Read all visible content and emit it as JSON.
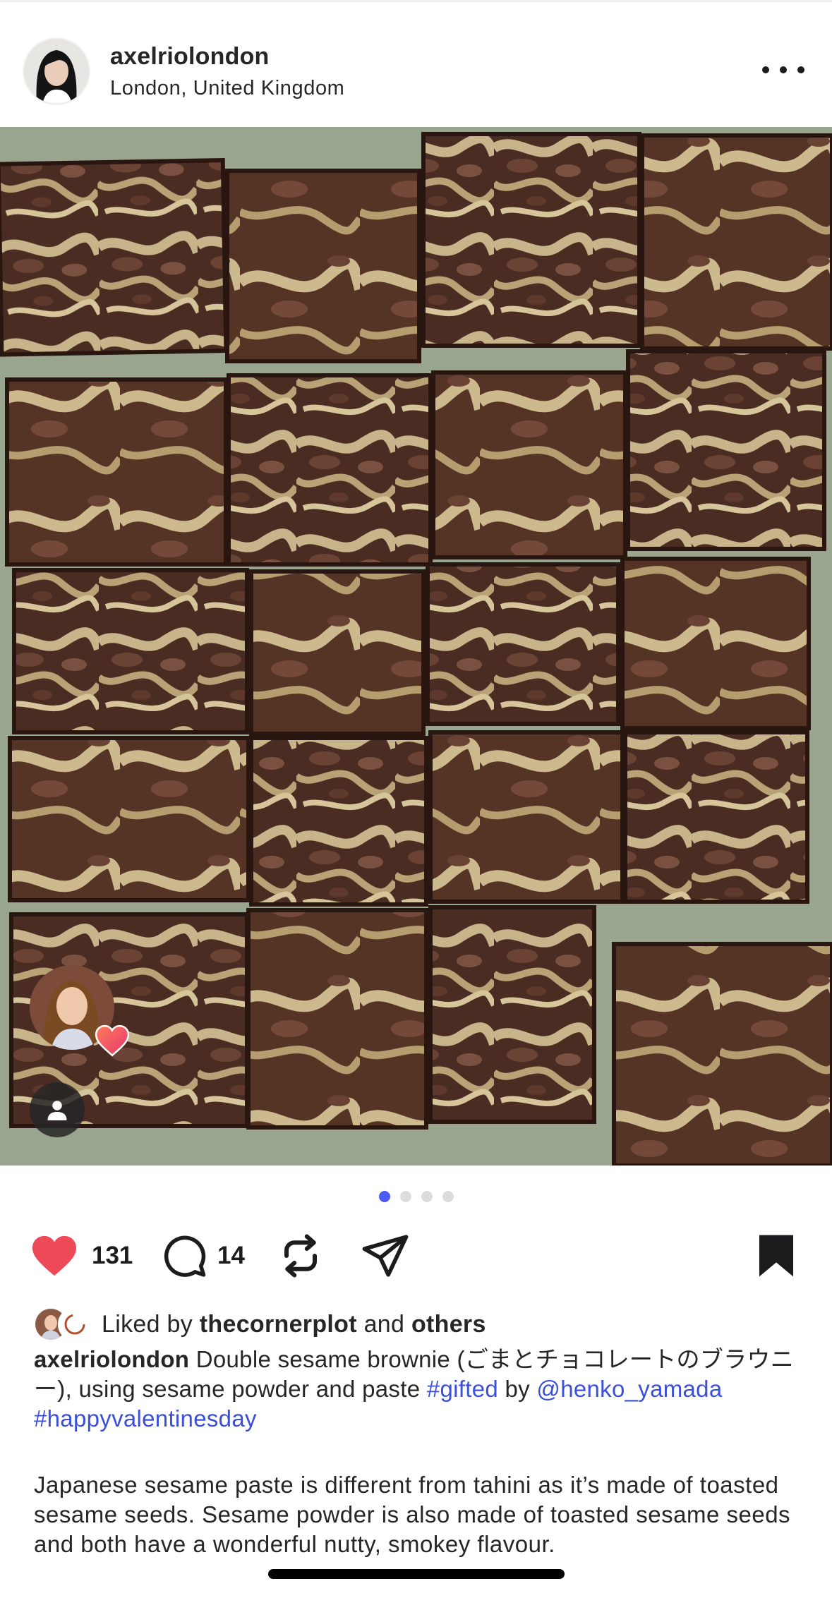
{
  "post": {
    "username": "axelriolondon",
    "location": "London, United Kingdom"
  },
  "media": {
    "alt_icon": "brownie-photo",
    "page_count": 4,
    "active_page": 1
  },
  "actions": {
    "like_count": "131",
    "comment_count": "14",
    "liked": true,
    "saved": true,
    "like_color": "#ed4956"
  },
  "likes": {
    "prefix": "Liked by",
    "user": "thecornerplot",
    "middle": "and",
    "others": "others"
  },
  "caption": {
    "author": "axelriolondon",
    "text_1": "Double sesame brownie (ごまとチョコレートのブラウニー), using sesame powder and paste",
    "hashtag_1": "#gifted",
    "text_2": "by",
    "mention": "@henko_yamada",
    "hashtag_2": "#happyvalentinesday",
    "paragraph": "Japanese sesame paste is different from tahini as it’s made of toasted sesame seeds. Sesame powder is also made of toasted sesame seeds and both have a wonderful nutty, smokey flavour."
  },
  "colors": {
    "link": "#3b4fd8",
    "dot_active": "#4a5cf2",
    "dot_inactive": "#dcdcdc"
  }
}
